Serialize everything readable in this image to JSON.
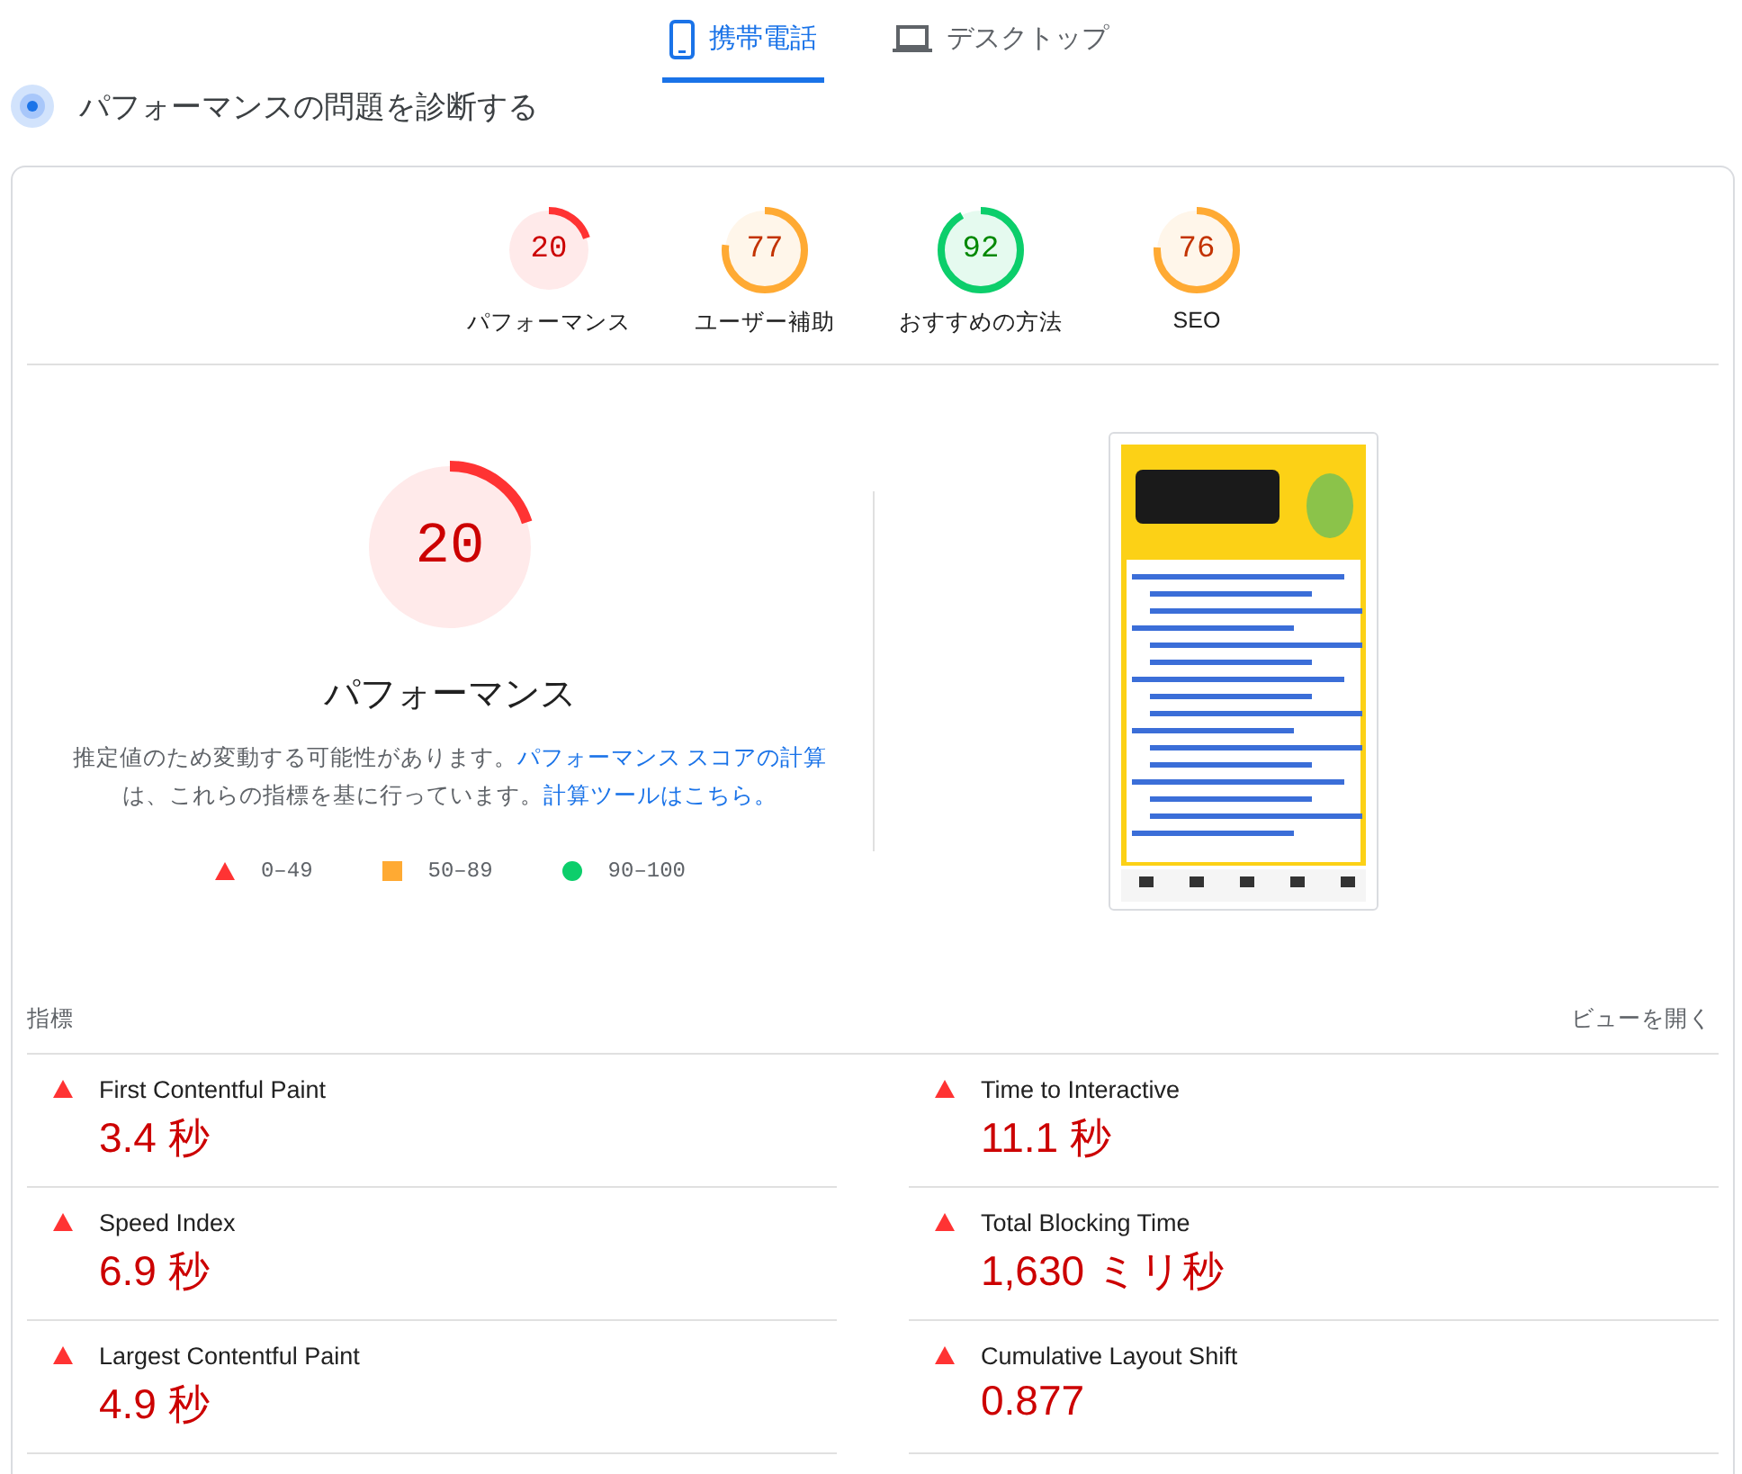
{
  "tabs": [
    {
      "label": "携帯電話",
      "kind": "phone",
      "selected": true
    },
    {
      "label": "デスクトップ",
      "kind": "laptop",
      "selected": false
    }
  ],
  "section_title": "パフォーマンスの問題を診断する",
  "gauges": [
    {
      "score": "20",
      "level": 0.2,
      "color": "#ff3333",
      "label": "パフォーマンス"
    },
    {
      "score": "77",
      "level": 0.77,
      "color": "#ffaa33",
      "label": "ユーザー補助"
    },
    {
      "score": "92",
      "level": 0.92,
      "color": "#0cce6b",
      "label": "おすすめの方法"
    },
    {
      "score": "76",
      "level": 0.76,
      "color": "#ffaa33",
      "label": "SEO"
    }
  ],
  "main_gauge": {
    "score": "20",
    "level": 0.2,
    "color": "#ff3333",
    "label": "パフォーマンス"
  },
  "description": {
    "text": "推定値のため変動する可能性があります。",
    "link": "パフォーマンス スコアの計算",
    "text_2": "は、これらの指標を基に行っています。",
    "link_2": "計算ツールはこちら。"
  },
  "legend": [
    {
      "kind": "triangle",
      "color": "#ff3333",
      "label": "0–49"
    },
    {
      "kind": "square",
      "color": "#ffaa33",
      "label": "50–89"
    },
    {
      "kind": "circle",
      "color": "#0cce6b",
      "label": "90–100"
    }
  ],
  "metrics_header": {
    "title": "指標",
    "action": "ビューを開く"
  },
  "metrics": [
    {
      "name": "First Contentful Paint",
      "value": "3.4 秒",
      "kind": "triangle",
      "color": "#ff3333"
    },
    {
      "name": "Time to Interactive",
      "value": "11.1 秒",
      "kind": "triangle",
      "color": "#ff3333"
    },
    {
      "name": "Speed Index",
      "value": "6.9 秒",
      "kind": "triangle",
      "color": "#ff3333"
    },
    {
      "name": "Total Blocking Time",
      "value": "1,630 ミリ秒",
      "kind": "triangle",
      "color": "#ff3333"
    },
    {
      "name": "Largest Contentful Paint",
      "value": "4.9 秒",
      "kind": "triangle",
      "color": "#ff3333"
    },
    {
      "name": "Cumulative Layout Shift",
      "value": "0.877",
      "kind": "triangle",
      "color": "#ff3333"
    }
  ]
}
